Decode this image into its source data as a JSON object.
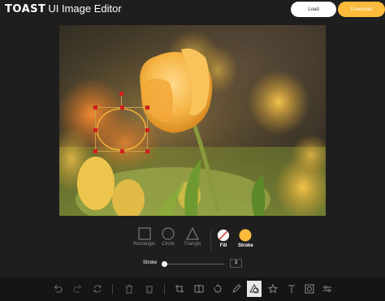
{
  "header": {
    "brand_logo": "TOAST",
    "brand_title": "UI Image Editor",
    "load_label": "Load",
    "download_label": "Download"
  },
  "canvas": {
    "image": "yellow-tulips-photo",
    "selected_shape": "circle"
  },
  "shape_menu": {
    "options": [
      {
        "label": "Rectangle",
        "icon": "rectangle-icon"
      },
      {
        "label": "Circle",
        "icon": "circle-icon"
      },
      {
        "label": "Triangle",
        "icon": "triangle-icon"
      }
    ],
    "fill_label": "Fill",
    "stroke_label": "Stroke",
    "fill_color": "transparent",
    "stroke_color": "#fdba3b"
  },
  "stroke_width": {
    "label": "Stroke",
    "value": "3"
  },
  "toolbar": {
    "items": [
      "undo-icon",
      "redo-icon",
      "reset-icon",
      "delete-icon",
      "delete-all-icon",
      "crop-icon",
      "flip-icon",
      "rotate-icon",
      "draw-icon",
      "shape-icon",
      "icon-icon",
      "text-icon",
      "mask-icon",
      "filter-icon"
    ],
    "active": "shape-icon"
  },
  "colors": {
    "accent": "#fdba3b",
    "background": "#1e1e1e",
    "handle": "#d02020"
  }
}
